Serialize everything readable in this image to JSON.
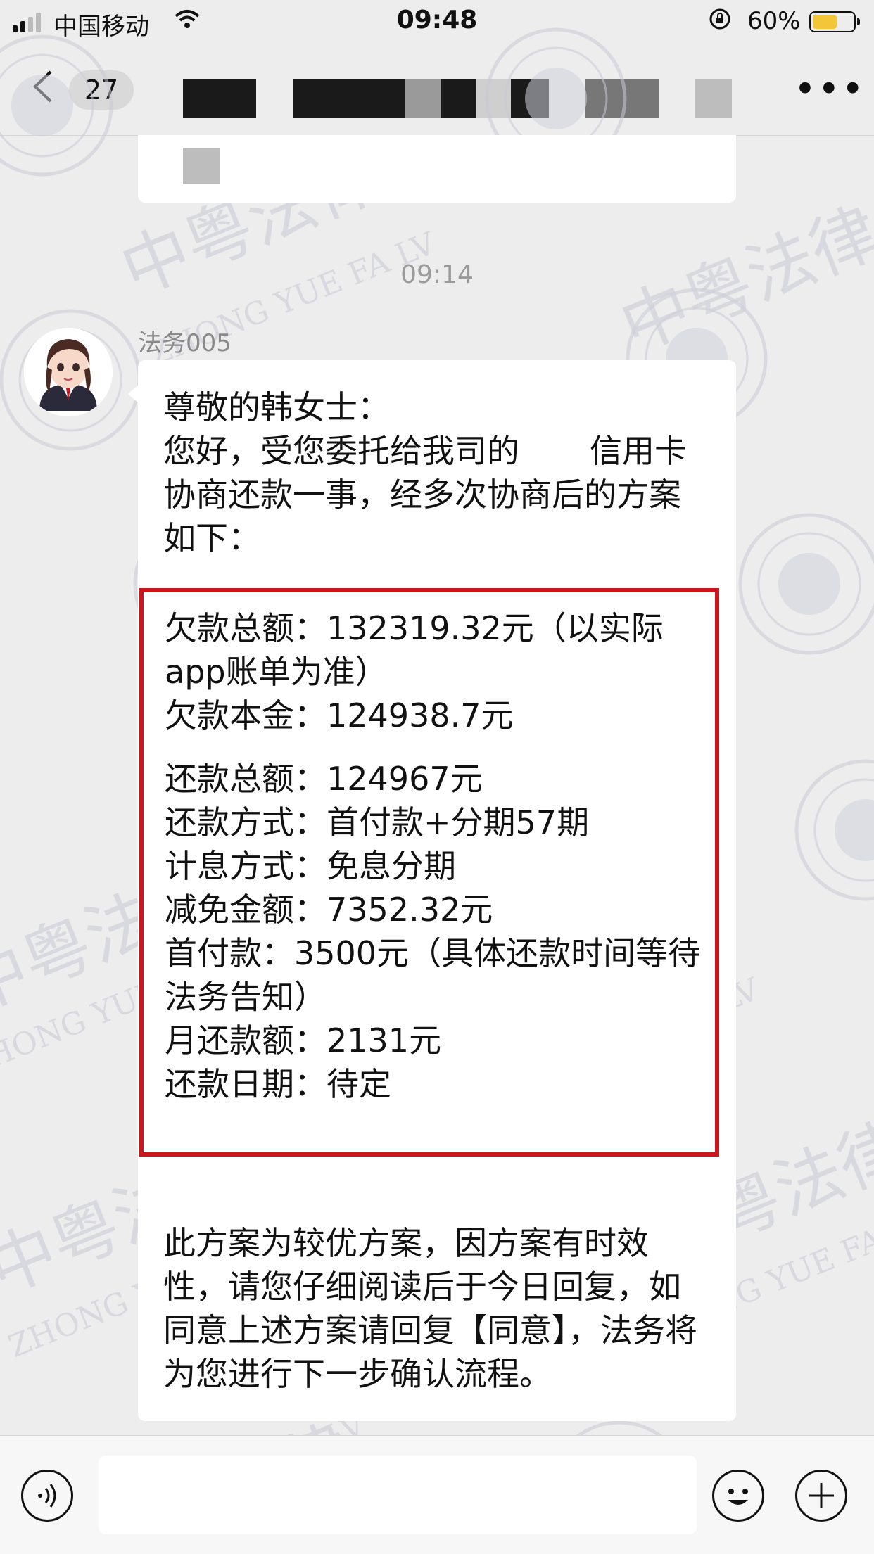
{
  "status_bar": {
    "carrier": "中国移动",
    "time": "09:48",
    "battery_percent_text": "60%",
    "battery_level": 0.6,
    "battery_color": "#f3c63a"
  },
  "nav": {
    "unread_count": "27",
    "back_icon": "chevron-left-icon",
    "more_icon": "more-icon"
  },
  "chat": {
    "timestamp": "09:14",
    "sender_name": "法务005",
    "message": {
      "greeting_line1": "尊敬的韩女士：",
      "greeting_line2a": "您好，受您委托给我司的",
      "greeting_line2b": "信用卡协商还款一事，经多次协商后的方案如下：",
      "plan": [
        "欠款总额：132319.32元（以实际app账单为准）",
        "欠款本金：124938.7元",
        "",
        "还款总额：124967元",
        "还款方式：首付款+分期57期",
        "计息方式：免息分期",
        "减免金额：7352.32元",
        "首付款：3500元（具体还款时间等待法务告知）",
        "月还款额：2131元",
        "还款日期：待定"
      ],
      "closing": "此方案为较优方案，因方案有时效性，请您仔细阅读后于今日回复，如同意上述方案请回复【同意】，法务将为您进行下一步确认流程。"
    },
    "highlight_color": "#c9171e"
  },
  "watermark": {
    "cn": "中粤法律",
    "en": "ZHONG YUE FA LV",
    "logo_char": "中"
  },
  "input_bar": {
    "voice_icon": "voice-icon",
    "emoji_icon": "emoji-icon",
    "plus_icon": "plus-icon"
  }
}
